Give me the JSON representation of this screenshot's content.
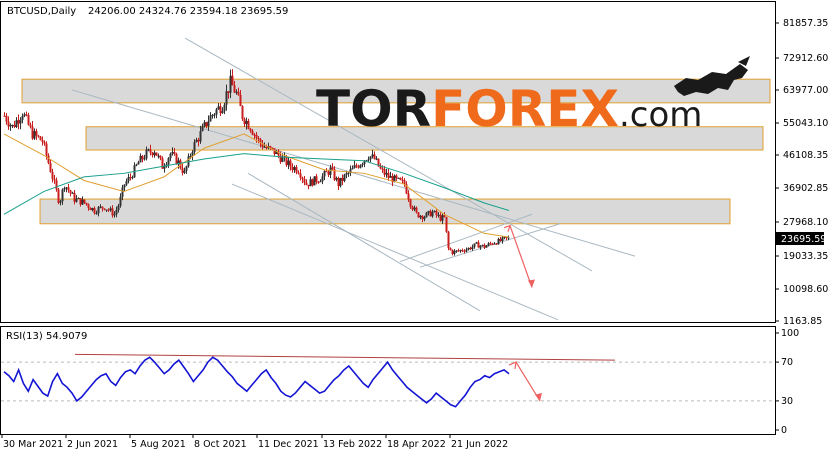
{
  "chart_data": {
    "type": "candlestick",
    "symbol_header": "BTCUSD,Daily",
    "ohlc_header": "24206.00 24324.76 23594.18 23695.59",
    "last_price_label": "23695.59",
    "ylim": [
      1163.85,
      90000
    ],
    "price_ticks": [
      "81857.35",
      "72912.60",
      "63977.00",
      "55043.10",
      "46108.35",
      "36902.85",
      "27968.10",
      "19033.35",
      "10098.60",
      "1163.85"
    ],
    "x_labels": [
      "30 Mar 2021",
      "2 Jun 2021",
      "5 Aug 2021",
      "8 Oct 2021",
      "11 Dec 2021",
      "13 Feb 2022",
      "18 Apr 2022",
      "21 Jun 2022"
    ],
    "close_anchors": [
      [
        0,
        57000
      ],
      [
        8,
        54000
      ],
      [
        18,
        58000
      ],
      [
        28,
        52000
      ],
      [
        38,
        50000
      ],
      [
        48,
        40000
      ],
      [
        55,
        33000
      ],
      [
        60,
        38000
      ],
      [
        70,
        34000
      ],
      [
        80,
        33000
      ],
      [
        90,
        31000
      ],
      [
        100,
        32000
      ],
      [
        110,
        30000
      ],
      [
        115,
        33000
      ],
      [
        120,
        38000
      ],
      [
        126,
        40000
      ],
      [
        134,
        44000
      ],
      [
        142,
        46500
      ],
      [
        150,
        47500
      ],
      [
        158,
        43000
      ],
      [
        166,
        46500
      ],
      [
        174,
        44000
      ],
      [
        180,
        41000
      ],
      [
        188,
        48000
      ],
      [
        196,
        52000
      ],
      [
        204,
        56000
      ],
      [
        210,
        58000
      ],
      [
        218,
        60000
      ],
      [
        226,
        66000
      ],
      [
        232,
        63000
      ],
      [
        238,
        57000
      ],
      [
        246,
        54000
      ],
      [
        254,
        50000
      ],
      [
        262,
        48000
      ],
      [
        270,
        47000
      ],
      [
        278,
        45000
      ],
      [
        286,
        43000
      ],
      [
        294,
        42000
      ],
      [
        302,
        38000
      ],
      [
        310,
        39000
      ],
      [
        318,
        40000
      ],
      [
        326,
        42000
      ],
      [
        334,
        38000
      ],
      [
        340,
        40000
      ],
      [
        348,
        42000
      ],
      [
        356,
        44000
      ],
      [
        364,
        46000
      ],
      [
        370,
        45000
      ],
      [
        376,
        42000
      ],
      [
        384,
        40000
      ],
      [
        392,
        39000
      ],
      [
        400,
        38000
      ],
      [
        406,
        33000
      ],
      [
        412,
        30000
      ],
      [
        420,
        29500
      ],
      [
        428,
        30500
      ],
      [
        436,
        29000
      ],
      [
        440,
        29000
      ],
      [
        444,
        21000
      ],
      [
        448,
        20000
      ],
      [
        456,
        20500
      ],
      [
        464,
        21000
      ],
      [
        472,
        22000
      ],
      [
        480,
        21500
      ],
      [
        488,
        22500
      ],
      [
        496,
        23000
      ],
      [
        500,
        23500
      ],
      [
        505,
        23700
      ]
    ],
    "ma_orange": [
      [
        0,
        52000
      ],
      [
        40,
        46000
      ],
      [
        80,
        39000
      ],
      [
        120,
        36000
      ],
      [
        160,
        40000
      ],
      [
        200,
        48000
      ],
      [
        240,
        52000
      ],
      [
        280,
        46000
      ],
      [
        320,
        42000
      ],
      [
        360,
        41000
      ],
      [
        400,
        38000
      ],
      [
        440,
        30000
      ],
      [
        480,
        25000
      ],
      [
        505,
        24000
      ]
    ],
    "ma_teal": [
      [
        0,
        30000
      ],
      [
        40,
        36000
      ],
      [
        80,
        40000
      ],
      [
        120,
        41000
      ],
      [
        160,
        43000
      ],
      [
        200,
        45000
      ],
      [
        240,
        46500
      ],
      [
        280,
        45500
      ],
      [
        320,
        45000
      ],
      [
        360,
        44500
      ],
      [
        400,
        41000
      ],
      [
        440,
        37000
      ],
      [
        480,
        33000
      ],
      [
        505,
        31000
      ]
    ],
    "resistance_zones": [
      [
        60500,
        67000
      ],
      [
        47500,
        54000
      ],
      [
        27500,
        34000
      ]
    ],
    "trendlines": [
      [
        [
          72,
          64000
        ],
        [
          635,
          19000
        ]
      ],
      [
        [
          185,
          78000
        ],
        [
          592,
          15000
        ]
      ],
      [
        [
          248,
          41000
        ],
        [
          480,
          4000
        ]
      ],
      [
        [
          232,
          38000
        ],
        [
          558,
          1500
        ]
      ],
      [
        [
          420,
          16000
        ],
        [
          560,
          27500
        ]
      ],
      [
        [
          400,
          17500
        ],
        [
          532,
          30000
        ]
      ]
    ],
    "forecast_arrow": [
      [
        510,
        27000
      ],
      [
        532,
        10500
      ]
    ],
    "rsi": {
      "label": "RSI(13) 54.9079",
      "levels": [
        "70",
        "30"
      ],
      "ticks": [
        "100",
        "70",
        "30",
        "0"
      ],
      "values": [
        60,
        56,
        50,
        62,
        48,
        40,
        52,
        45,
        38,
        35,
        50,
        58,
        48,
        44,
        38,
        30,
        34,
        40,
        46,
        52,
        56,
        58,
        50,
        46,
        54,
        60,
        62,
        58,
        66,
        72,
        75,
        70,
        64,
        58,
        62,
        68,
        72,
        65,
        58,
        50,
        56,
        62,
        70,
        75,
        72,
        66,
        60,
        55,
        48,
        44,
        40,
        46,
        52,
        58,
        62,
        54,
        48,
        40,
        36,
        34,
        38,
        44,
        50,
        46,
        42,
        38,
        40,
        46,
        52,
        56,
        62,
        66,
        60,
        54,
        48,
        44,
        52,
        58,
        64,
        70,
        62,
        56,
        50,
        44,
        40,
        36,
        32,
        28,
        32,
        38,
        34,
        30,
        26,
        24,
        30,
        36,
        44,
        50,
        52,
        56,
        54,
        58,
        60,
        62,
        58
      ]
    },
    "rsi_trendline": [
      [
        75,
        78
      ],
      [
        615,
        72
      ]
    ],
    "rsi_arrow": [
      [
        516,
        70
      ],
      [
        540,
        30
      ]
    ],
    "watermark": "TORFOREX.com"
  }
}
